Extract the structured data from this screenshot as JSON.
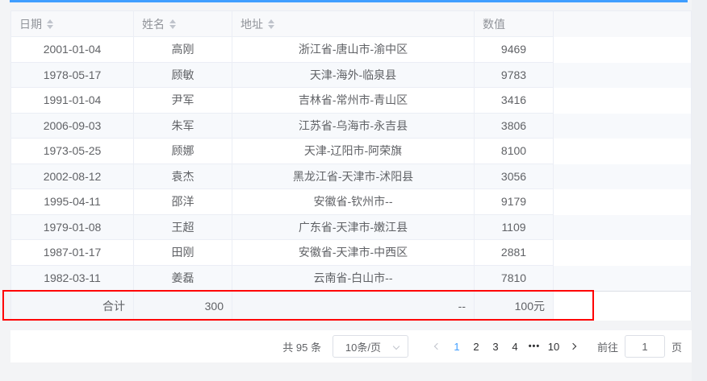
{
  "colors": {
    "accent": "#409eff",
    "highlight_border": "#ff0000",
    "active_page_color": "#409eff"
  },
  "table": {
    "columns": [
      {
        "key": "date",
        "label": "日期",
        "sortable": true
      },
      {
        "key": "name",
        "label": "姓名",
        "sortable": true
      },
      {
        "key": "address",
        "label": "地址",
        "sortable": true
      },
      {
        "key": "value",
        "label": "数值",
        "sortable": false
      }
    ],
    "rows": [
      {
        "date": "2001-01-04",
        "name": "高刚",
        "address": "浙江省-唐山市-渝中区",
        "value": "9469"
      },
      {
        "date": "1978-05-17",
        "name": "顾敏",
        "address": "天津-海外-临泉县",
        "value": "9783"
      },
      {
        "date": "1991-01-04",
        "name": "尹军",
        "address": "吉林省-常州市-青山区",
        "value": "3416"
      },
      {
        "date": "2006-09-03",
        "name": "朱军",
        "address": "江苏省-乌海市-永吉县",
        "value": "3806"
      },
      {
        "date": "1973-05-25",
        "name": "顾娜",
        "address": "天津-辽阳市-阿荣旗",
        "value": "8100"
      },
      {
        "date": "2002-08-12",
        "name": "袁杰",
        "address": "黑龙江省-天津市-沭阳县",
        "value": "3056"
      },
      {
        "date": "1995-04-11",
        "name": "邵洋",
        "address": "安徽省-钦州市--",
        "value": "9179"
      },
      {
        "date": "1979-01-08",
        "name": "王超",
        "address": "广东省-天津市-嫩江县",
        "value": "1109"
      },
      {
        "date": "1987-01-17",
        "name": "田刚",
        "address": "安徽省-天津市-中西区",
        "value": "2881"
      },
      {
        "date": "1982-03-11",
        "name": "姜磊",
        "address": "云南省-白山市--",
        "value": "7810"
      }
    ],
    "summary": {
      "date": "合计",
      "name": "300",
      "address": "--",
      "value": "100元"
    }
  },
  "pagination": {
    "total_label": "共 95 条",
    "page_size_label": "10条/页",
    "pages": [
      {
        "label": "1",
        "active": true
      },
      {
        "label": "2"
      },
      {
        "label": "3"
      },
      {
        "label": "4"
      },
      {
        "label": "•••",
        "ellipsis": true
      },
      {
        "label": "10"
      }
    ],
    "goto_label": "前往",
    "goto_value": "1",
    "page_unit": "页"
  }
}
